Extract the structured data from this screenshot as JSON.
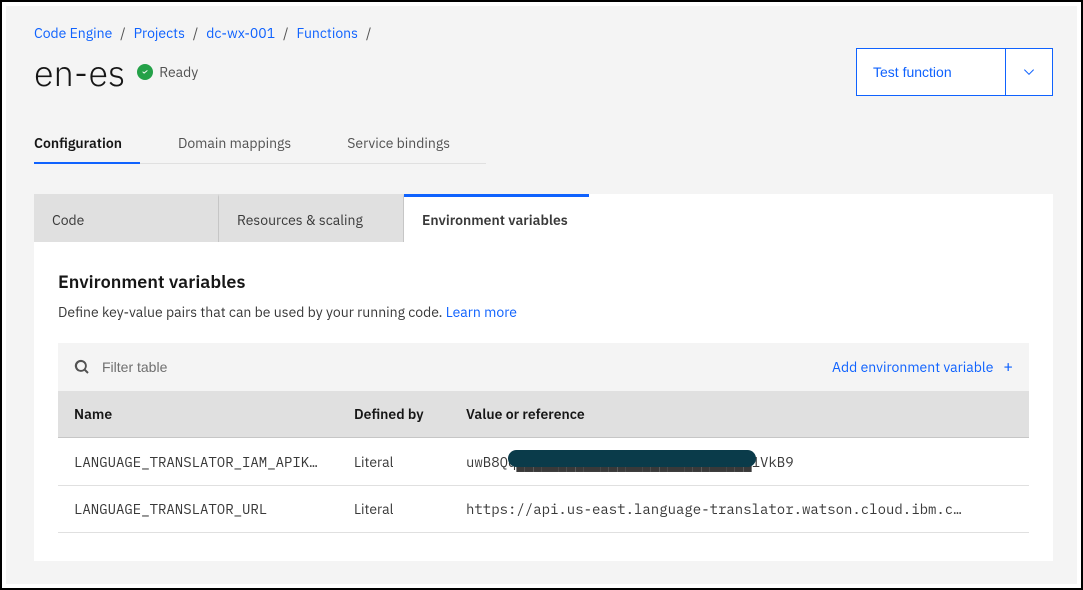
{
  "breadcrumb": [
    {
      "label": "Code Engine"
    },
    {
      "label": "Projects"
    },
    {
      "label": "dc-wx-001"
    },
    {
      "label": "Functions"
    }
  ],
  "title": "en-es",
  "status": {
    "label": "Ready"
  },
  "actions": {
    "test": "Test function"
  },
  "primary_tabs": [
    {
      "label": "Configuration",
      "active": true
    },
    {
      "label": "Domain mappings",
      "active": false
    },
    {
      "label": "Service bindings",
      "active": false
    }
  ],
  "sub_tabs": [
    {
      "label": "Code",
      "active": false
    },
    {
      "label": "Resources & scaling",
      "active": false
    },
    {
      "label": "Environment variables",
      "active": true
    }
  ],
  "env_section": {
    "title": "Environment variables",
    "description": "Define key-value pairs that can be used by your running code. ",
    "learn_more": "Learn more",
    "filter_placeholder": "Filter table",
    "add_label": "Add environment variable",
    "columns": {
      "name": "Name",
      "defined_by": "Defined by",
      "value": "Value or reference"
    },
    "rows": [
      {
        "name": "LANGUAGE_TRANSLATOR_IAM_APIKEY",
        "defined_by": "Literal",
        "value": "uwB8Qq████████████████████████████1VkB9",
        "redacted": true
      },
      {
        "name": "LANGUAGE_TRANSLATOR_URL",
        "defined_by": "Literal",
        "value": "https://api.us-east.language-translator.watson.cloud.ibm.c…",
        "redacted": false
      }
    ]
  }
}
